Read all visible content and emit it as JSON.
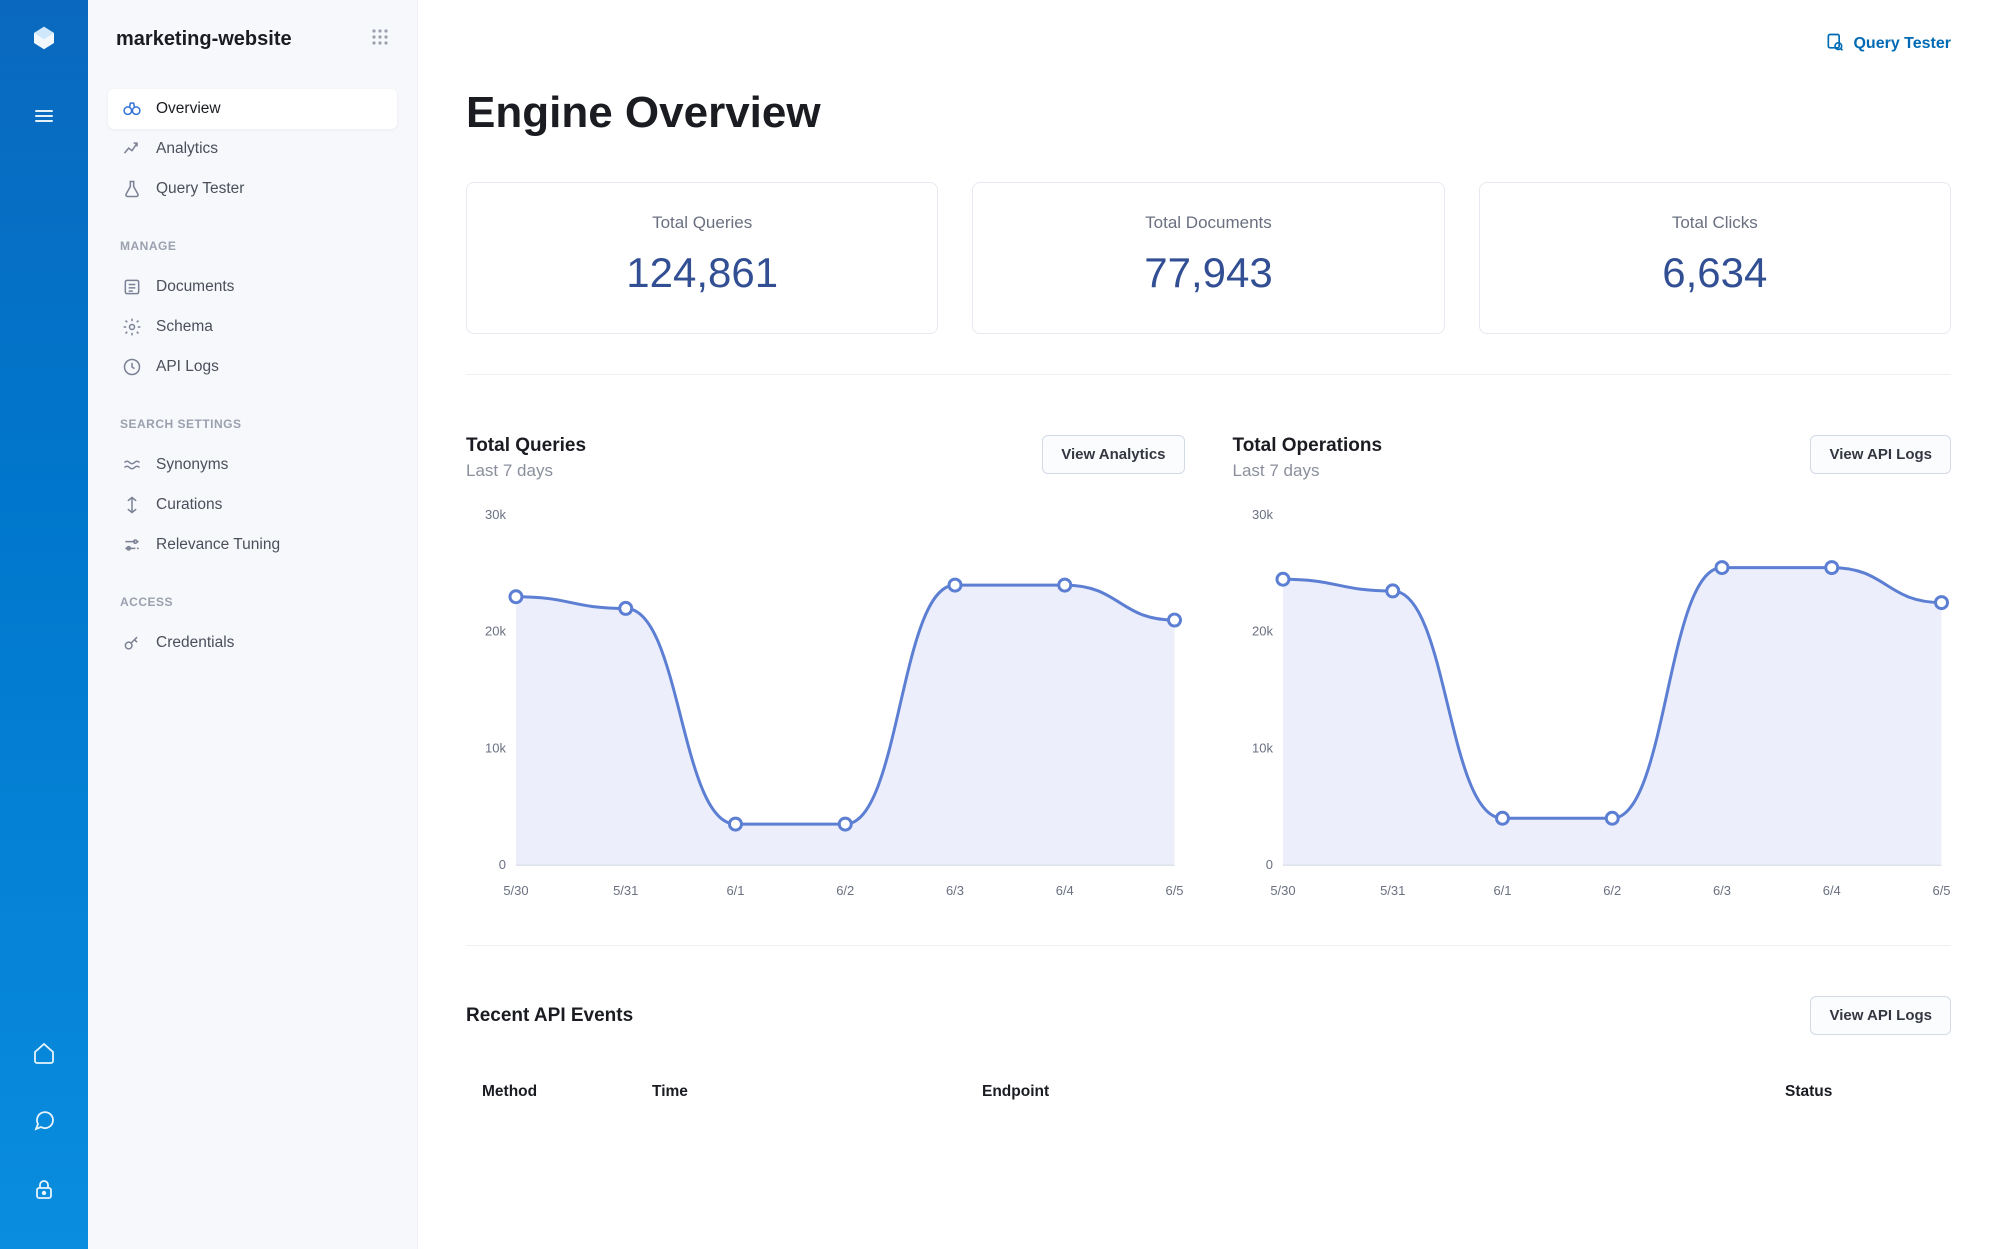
{
  "engine_name": "marketing-website",
  "topbar": {
    "query_tester": "Query Tester"
  },
  "sidebar": {
    "primary": [
      {
        "id": "overview",
        "label": "Overview",
        "icon": "binoculars-icon"
      },
      {
        "id": "analytics",
        "label": "Analytics",
        "icon": "analytics-icon"
      },
      {
        "id": "query-tester",
        "label": "Query Tester",
        "icon": "flask-icon"
      }
    ],
    "manage_heading": "MANAGE",
    "manage": [
      {
        "id": "documents",
        "label": "Documents",
        "icon": "documents-icon"
      },
      {
        "id": "schema",
        "label": "Schema",
        "icon": "gear-icon"
      },
      {
        "id": "api-logs",
        "label": "API Logs",
        "icon": "clock-icon"
      }
    ],
    "search_heading": "SEARCH SETTINGS",
    "search": [
      {
        "id": "synonyms",
        "label": "Synonyms",
        "icon": "waves-icon"
      },
      {
        "id": "curations",
        "label": "Curations",
        "icon": "tuning-icon"
      },
      {
        "id": "relevance",
        "label": "Relevance Tuning",
        "icon": "sliders-icon"
      }
    ],
    "access_heading": "ACCESS",
    "access": [
      {
        "id": "credentials",
        "label": "Credentials",
        "icon": "key-icon"
      }
    ]
  },
  "page_title": "Engine Overview",
  "stats": [
    {
      "label": "Total Queries",
      "value": "124,861"
    },
    {
      "label": "Total Documents",
      "value": "77,943"
    },
    {
      "label": "Total Clicks",
      "value": "6,634"
    }
  ],
  "charts": {
    "queries": {
      "title": "Total Queries",
      "subtitle": "Last 7 days",
      "button": "View Analytics"
    },
    "operations": {
      "title": "Total Operations",
      "subtitle": "Last 7 days",
      "button": "View API Logs"
    }
  },
  "recent_events": {
    "title": "Recent API Events",
    "button": "View API Logs",
    "columns": [
      "Method",
      "Time",
      "Endpoint",
      "Status"
    ]
  },
  "chart_data": [
    {
      "type": "line",
      "title": "Total Queries",
      "subtitle": "Last 7 days",
      "xlabel": "",
      "ylabel": "",
      "ylim": [
        0,
        30000
      ],
      "y_ticks": [
        "0",
        "10k",
        "20k",
        "30k"
      ],
      "categories": [
        "5/30",
        "5/31",
        "6/1",
        "6/2",
        "6/3",
        "6/4",
        "6/5"
      ],
      "values": [
        23000,
        22000,
        3500,
        3500,
        24000,
        24000,
        21000
      ]
    },
    {
      "type": "line",
      "title": "Total Operations",
      "subtitle": "Last 7 days",
      "xlabel": "",
      "ylabel": "",
      "ylim": [
        0,
        30000
      ],
      "y_ticks": [
        "0",
        "10k",
        "20k",
        "30k"
      ],
      "categories": [
        "5/30",
        "5/31",
        "6/1",
        "6/2",
        "6/3",
        "6/4",
        "6/5"
      ],
      "values": [
        24500,
        23500,
        4000,
        4000,
        25500,
        25500,
        22500
      ]
    }
  ]
}
